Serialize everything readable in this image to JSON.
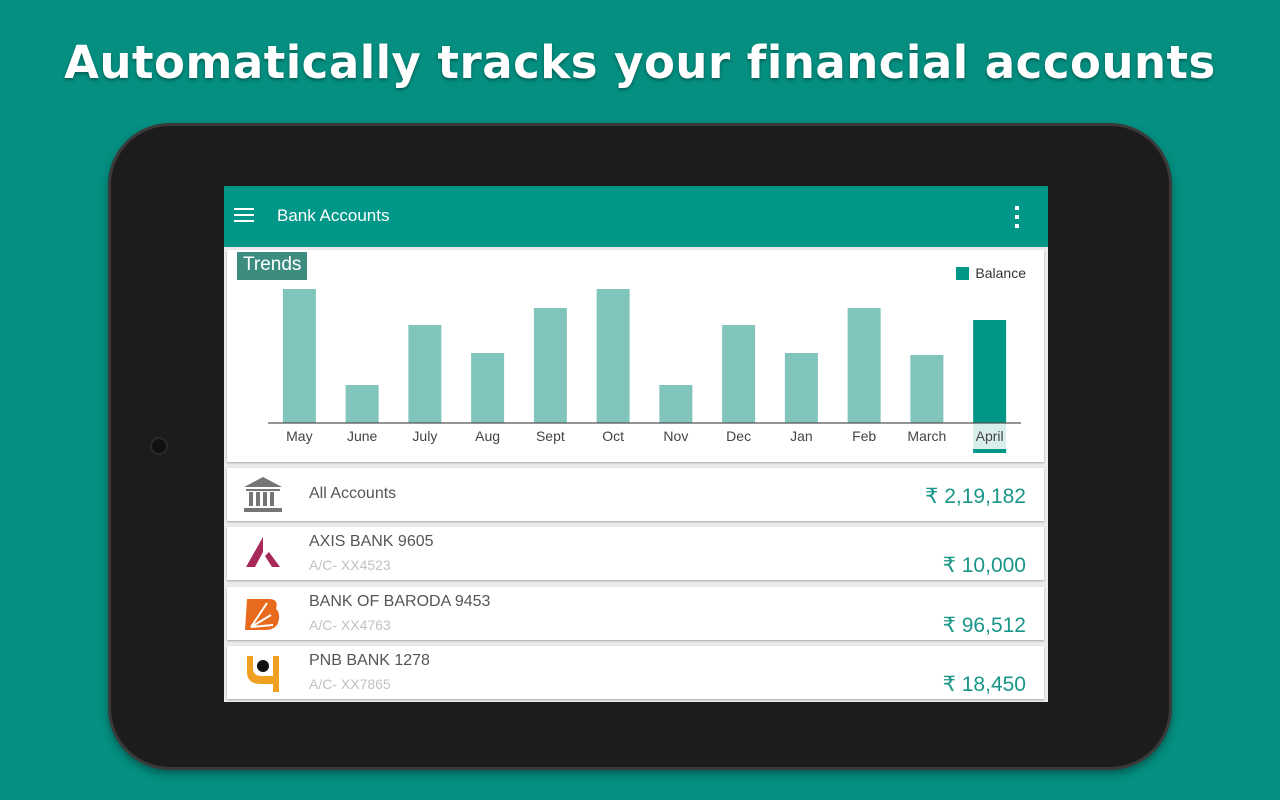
{
  "headline": "Automatically tracks your financial accounts",
  "app": {
    "title": "Bank Accounts",
    "menu_icon": "hamburger-menu-icon",
    "more_icon": "more-vertical-icon"
  },
  "chart_data": {
    "type": "bar",
    "title": "Trends",
    "legend": "top-right",
    "categories": [
      "May",
      "June",
      "July",
      "Aug",
      "Sept",
      "Oct",
      "Nov",
      "Dec",
      "Jan",
      "Feb",
      "March",
      "April"
    ],
    "series": [
      {
        "name": "Balance",
        "values": [
          134,
          38,
          98,
          70,
          115,
          134,
          38,
          98,
          70,
          115,
          68,
          103
        ]
      }
    ],
    "selected": "April",
    "ylim": [
      0,
      134
    ],
    "grid": false,
    "colors": {
      "bar": "#80c4bb",
      "selected": "#009688"
    }
  },
  "accounts": {
    "all": {
      "label": "All Accounts",
      "amount": "₹ 2,19,182",
      "icon": "bank-building-icon"
    },
    "items": [
      {
        "name": "AXIS BANK 9605",
        "acno": "A/C- XX4523",
        "amount": "₹ 10,000",
        "icon": "axis-bank-logo"
      },
      {
        "name": "BANK OF BARODA 9453",
        "acno": "A/C- XX4763",
        "amount": "₹ 96,512",
        "icon": "bank-of-baroda-logo"
      },
      {
        "name": "PNB BANK 1278",
        "acno": "A/C- XX7865",
        "amount": "₹ 18,450",
        "icon": "pnb-logo"
      }
    ]
  }
}
